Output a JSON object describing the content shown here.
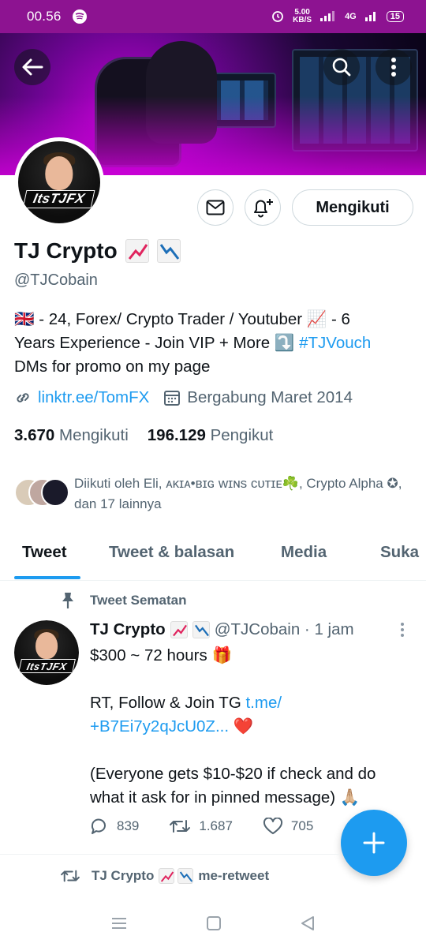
{
  "status_bar": {
    "time": "00.56",
    "speed_value": "5.00",
    "speed_unit": "KB/S",
    "network": "4G",
    "battery": "15"
  },
  "profile": {
    "name": "TJ Crypto",
    "handle": "@TJCobain",
    "avatar_text": "ItsTJFX",
    "bio_line1": "🇬🇧 - 24, Forex/ Crypto Trader / Youtuber 📈 - 6",
    "bio_line2_prefix": "Years Experience - Join VIP + More ⤵️ ",
    "bio_hashtag": "#TJVouch",
    "bio_line3": "DMs for promo on my page",
    "link": "linktr.ee/TomFX",
    "joined": "Bergabung Maret 2014",
    "following_count": "3.670",
    "following_label": "Mengikuti",
    "followers_count": "196.129",
    "followers_label": "Pengikut",
    "followed_by": "Diikuti oleh Eli, ᴀᴋɪᴀ•ʙɪɢ ᴡɪɴs ᴄᴜᴛɪᴇ☘️, Crypto Alpha ✪, dan 17 lainnya"
  },
  "buttons": {
    "follow": "Mengikuti"
  },
  "tabs": [
    {
      "label": "Tweet"
    },
    {
      "label": "Tweet & balasan"
    },
    {
      "label": "Media"
    },
    {
      "label": "Suka"
    }
  ],
  "pinned_tweet": {
    "pinned_label": "Tweet Sematan",
    "author": "TJ Crypto",
    "handle_time": "@TJCobain · 1 jam",
    "line1": "$300 ~ 72 hours 🎁",
    "line2_prefix": "RT, Follow & Join TG ",
    "line2_link": "t.me/",
    "line3_link": "+B7Ei7y2qJcU0Z...",
    "line3_suffix": " ❤️",
    "line4": "(Everyone gets $10-$20 if check and do what it ask for in pinned message) 🙏🏼",
    "replies": "839",
    "retweets": "1.687",
    "likes": "705"
  },
  "retweet_row": {
    "label": "me-retweet",
    "author": "TJ Crypto"
  },
  "colors": {
    "accent": "#1d9bf0",
    "statusbar": "#8d1391",
    "text": "#0f1419",
    "muted": "#536471"
  }
}
